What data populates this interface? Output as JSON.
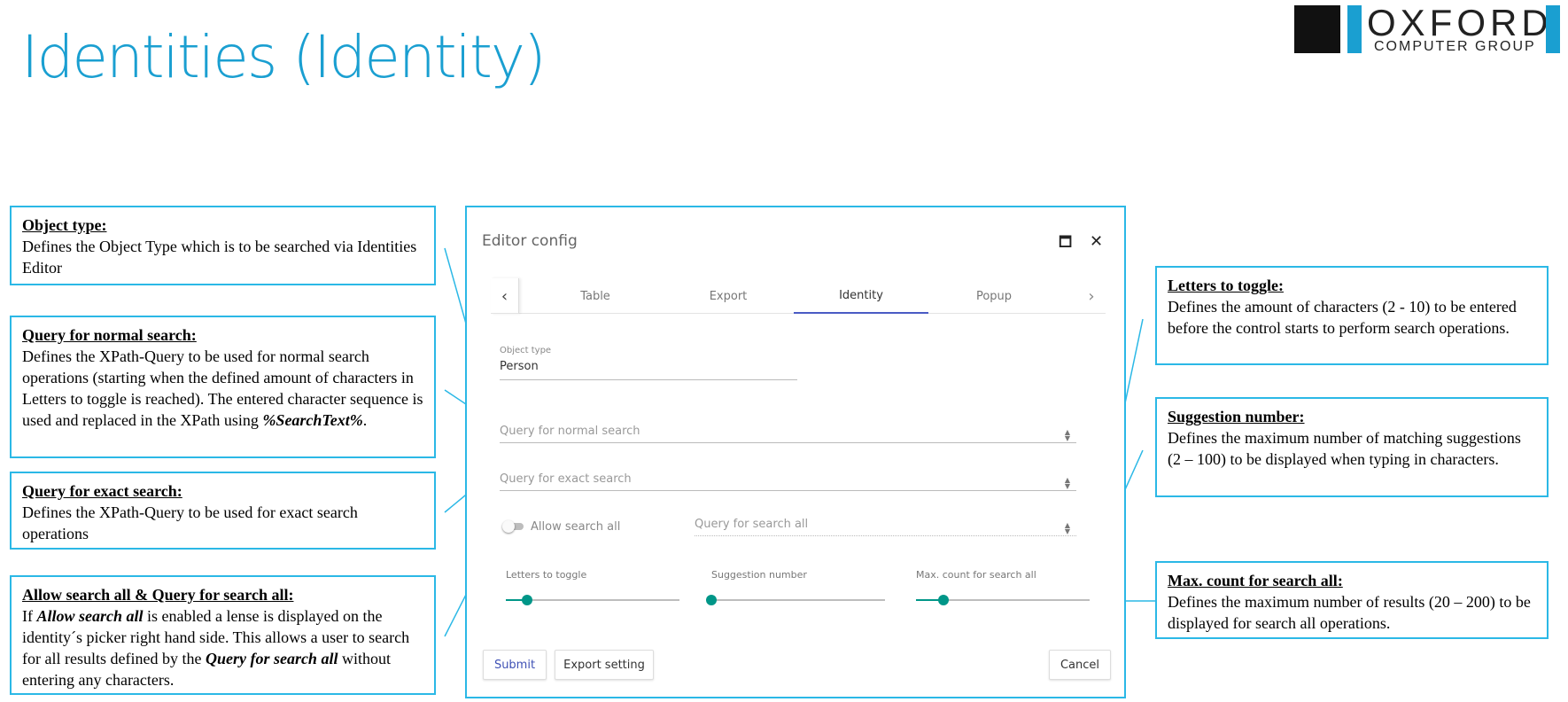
{
  "page": {
    "title": "Identities (Identity)"
  },
  "logo": {
    "line1": "OXFORD",
    "line2": "COMPUTER GROUP"
  },
  "callouts": {
    "object_type": {
      "heading": "Object type:",
      "body": "Defines the Object Type which is to be searched via Identities Editor"
    },
    "query_normal": {
      "heading": "Query for normal search:",
      "body": "Defines the XPath-Query to be used for normal search operations (starting when the defined amount of characters in Letters to toggle is reached). The entered character sequence is used and replaced in the XPath using ",
      "emph": "%SearchText%",
      "end": "."
    },
    "query_exact": {
      "heading": "Query for exact search:",
      "body": "Defines the XPath-Query to be used for exact search operations"
    },
    "allow_search_all": {
      "heading": "Allow search all & Query for search all:",
      "p1": "If ",
      "e1": "Allow search all",
      "p2": " is enabled a lense is displayed on the identity´s picker right hand side. This allows a user to search for all results defined by the ",
      "e2": "Query for search all",
      "p3": " without entering any characters."
    },
    "letters_toggle": {
      "heading": "Letters to toggle:",
      "body": "Defines the amount of characters (2 - 10) to be entered before the control starts to perform search operations."
    },
    "suggestion_number": {
      "heading": "Suggestion number:",
      "body": "Defines the maximum number of matching suggestions (2 – 100) to be displayed when typing in characters."
    },
    "max_count": {
      "heading": "Max. count for search all:",
      "body": "Defines the maximum number of results (20 – 200) to be displayed for search all operations."
    }
  },
  "dialog": {
    "title": "Editor config",
    "maximize_icon": "maximize-icon",
    "close_icon": "close-icon",
    "tabs": [
      {
        "label": "Table",
        "active": false
      },
      {
        "label": "Export",
        "active": false
      },
      {
        "label": "Identity",
        "active": true
      },
      {
        "label": "Popup",
        "active": false
      }
    ],
    "object_type": {
      "label": "Object type",
      "value": "Person"
    },
    "query_normal": {
      "placeholder": "Query for normal search"
    },
    "query_exact": {
      "placeholder": "Query for exact search"
    },
    "allow_search_all": {
      "label": "Allow search all",
      "enabled": false
    },
    "query_search_all": {
      "placeholder": "Query for search all"
    },
    "sliders": [
      {
        "label": "Letters to toggle",
        "fraction": 0.12
      },
      {
        "label": "Suggestion number",
        "fraction": 0.0
      },
      {
        "label": "Max. count for search all",
        "fraction": 0.16
      }
    ],
    "buttons": {
      "submit": "Submit",
      "export": "Export setting",
      "cancel": "Cancel"
    }
  },
  "colors": {
    "accent": "#1a9fd1",
    "callout_border": "#2bb8e6",
    "slider": "#009688",
    "tab_indicator": "#4a5bc4"
  }
}
